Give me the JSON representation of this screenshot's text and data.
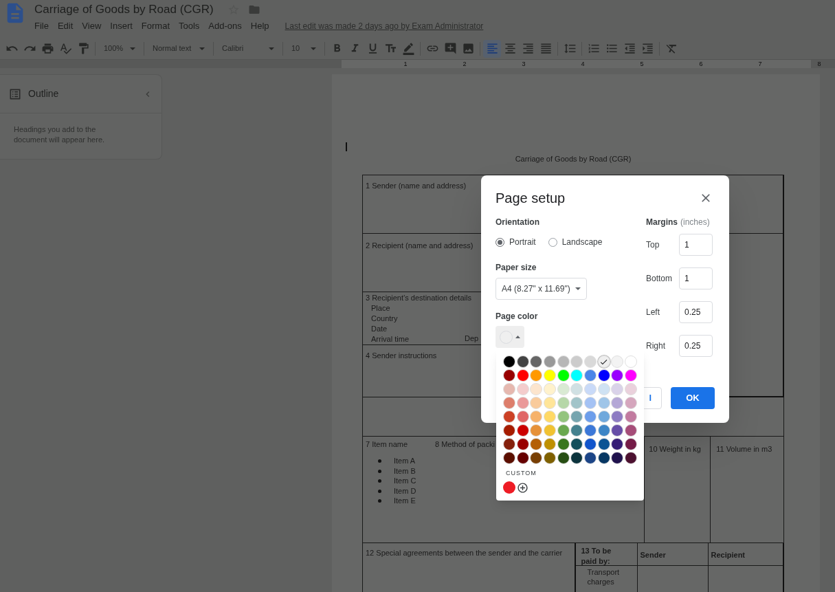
{
  "document": {
    "title": "Carriage of Goods by Road (CGR)"
  },
  "menu": [
    "File",
    "Edit",
    "View",
    "Insert",
    "Format",
    "Tools",
    "Add-ons",
    "Help"
  ],
  "last_edit": "Last edit was made 2 days ago by Exam Administrator",
  "toolbar": {
    "zoom": "100%",
    "style": "Normal text",
    "font": "Calibri",
    "size": "10",
    "align": [
      {
        "selected": true
      },
      {
        "selected": false
      },
      {
        "selected": false
      },
      {
        "selected": false
      }
    ]
  },
  "ruler": [
    "1",
    "2",
    "3",
    "4",
    "5",
    "6",
    "7",
    "8"
  ],
  "outline": {
    "title": "Outline",
    "hint": "Headings you add to the document will appear here."
  },
  "page": {
    "heading": "Carriage of Goods by Road (CGR)",
    "sender": "1 Sender (name and address)",
    "recipient": "2 Recipient (name and address)",
    "destination": {
      "title": "3 Recipient’s destination details",
      "fields": [
        "Place",
        "Country",
        "Date",
        "Arrival time"
      ],
      "column_2": "Dep"
    },
    "instructions": "4 Sender instructions",
    "items": {
      "item_name": "7 Item name",
      "packing": "8 Method of packi",
      "weight": "10 Weight in kg",
      "volume": "11 Volume in m3",
      "list": [
        "Item A",
        "Item B",
        "Item C",
        "Item D",
        "Item E"
      ]
    },
    "agreements": "12 Special agreements between the sender and the carrier",
    "payment": {
      "title": "13 To be paid by:",
      "columns": [
        "Sender",
        "Recipient"
      ],
      "rows": [
        "Transport charges"
      ]
    }
  },
  "dialog": {
    "title": "Page setup",
    "orientation": {
      "label": "Orientation",
      "options": [
        {
          "label": "Portrait",
          "selected": true
        },
        {
          "label": "Landscape",
          "selected": false
        }
      ]
    },
    "paper_size": {
      "label": "Paper size",
      "value": "A4 (8.27\" x 11.69\")"
    },
    "page_color": {
      "label": "Page color"
    },
    "margins": {
      "label": "Margins",
      "unit": "(inches)",
      "fields": [
        {
          "label": "Top",
          "value": "1"
        },
        {
          "label": "Bottom",
          "value": "1"
        },
        {
          "label": "Left",
          "value": "0.25"
        },
        {
          "label": "Right",
          "value": "0.25"
        }
      ]
    },
    "buttons": {
      "cancel": "l",
      "ok": "OK"
    }
  },
  "color_picker": {
    "palette": [
      [
        {
          "color": "#000000",
          "selected": false
        },
        {
          "color": "#434343",
          "selected": false
        },
        {
          "color": "#666666",
          "selected": false
        },
        {
          "color": "#999999",
          "selected": false
        },
        {
          "color": "#b7b7b7",
          "selected": false
        },
        {
          "color": "#cccccc",
          "selected": false
        },
        {
          "color": "#d9d9d9",
          "selected": false
        },
        {
          "color": "#efefef",
          "selected": true
        },
        {
          "color": "#f3f3f3",
          "selected": false
        },
        {
          "color": "#ffffff",
          "selected": false
        }
      ],
      [
        {
          "color": "#980000",
          "selected": false
        },
        {
          "color": "#ff0000",
          "selected": false
        },
        {
          "color": "#ff9900",
          "selected": false
        },
        {
          "color": "#ffff00",
          "selected": false
        },
        {
          "color": "#00ff00",
          "selected": false
        },
        {
          "color": "#00ffff",
          "selected": false
        },
        {
          "color": "#4a86e8",
          "selected": false
        },
        {
          "color": "#0000ff",
          "selected": false
        },
        {
          "color": "#9900ff",
          "selected": false
        },
        {
          "color": "#ff00ff",
          "selected": false
        }
      ],
      [
        {
          "color": "#e6b8af",
          "selected": false
        },
        {
          "color": "#f4cccc",
          "selected": false
        },
        {
          "color": "#fce5cd",
          "selected": false
        },
        {
          "color": "#fff2cc",
          "selected": false
        },
        {
          "color": "#d9ead3",
          "selected": false
        },
        {
          "color": "#d0e0e3",
          "selected": false
        },
        {
          "color": "#c9daf8",
          "selected": false
        },
        {
          "color": "#cfe2f3",
          "selected": false
        },
        {
          "color": "#d9d2e9",
          "selected": false
        },
        {
          "color": "#ead1dc",
          "selected": false
        }
      ],
      [
        {
          "color": "#dd7e6b",
          "selected": false
        },
        {
          "color": "#ea9999",
          "selected": false
        },
        {
          "color": "#f9cb9c",
          "selected": false
        },
        {
          "color": "#ffe599",
          "selected": false
        },
        {
          "color": "#b6d7a8",
          "selected": false
        },
        {
          "color": "#a2c4c9",
          "selected": false
        },
        {
          "color": "#a4c2f4",
          "selected": false
        },
        {
          "color": "#9fc5e8",
          "selected": false
        },
        {
          "color": "#b4a7d6",
          "selected": false
        },
        {
          "color": "#d5a6bd",
          "selected": false
        }
      ],
      [
        {
          "color": "#cc4125",
          "selected": false
        },
        {
          "color": "#e06666",
          "selected": false
        },
        {
          "color": "#f6b26b",
          "selected": false
        },
        {
          "color": "#ffd966",
          "selected": false
        },
        {
          "color": "#93c47d",
          "selected": false
        },
        {
          "color": "#76a5af",
          "selected": false
        },
        {
          "color": "#6d9eeb",
          "selected": false
        },
        {
          "color": "#6fa8dc",
          "selected": false
        },
        {
          "color": "#8e7cc3",
          "selected": false
        },
        {
          "color": "#c27ba0",
          "selected": false
        }
      ],
      [
        {
          "color": "#a61c00",
          "selected": false
        },
        {
          "color": "#cc0000",
          "selected": false
        },
        {
          "color": "#e69138",
          "selected": false
        },
        {
          "color": "#f1c232",
          "selected": false
        },
        {
          "color": "#6aa84f",
          "selected": false
        },
        {
          "color": "#45818e",
          "selected": false
        },
        {
          "color": "#3c78d8",
          "selected": false
        },
        {
          "color": "#3d85c6",
          "selected": false
        },
        {
          "color": "#674ea7",
          "selected": false
        },
        {
          "color": "#a64d79",
          "selected": false
        }
      ],
      [
        {
          "color": "#85200c",
          "selected": false
        },
        {
          "color": "#990000",
          "selected": false
        },
        {
          "color": "#b45f06",
          "selected": false
        },
        {
          "color": "#bf9000",
          "selected": false
        },
        {
          "color": "#38761d",
          "selected": false
        },
        {
          "color": "#134f5c",
          "selected": false
        },
        {
          "color": "#1155cc",
          "selected": false
        },
        {
          "color": "#0b5394",
          "selected": false
        },
        {
          "color": "#351c75",
          "selected": false
        },
        {
          "color": "#741b47",
          "selected": false
        }
      ],
      [
        {
          "color": "#5b0f00",
          "selected": false
        },
        {
          "color": "#660000",
          "selected": false
        },
        {
          "color": "#783f04",
          "selected": false
        },
        {
          "color": "#7f6000",
          "selected": false
        },
        {
          "color": "#274e13",
          "selected": false
        },
        {
          "color": "#0c343d",
          "selected": false
        },
        {
          "color": "#1c4587",
          "selected": false
        },
        {
          "color": "#073763",
          "selected": false
        },
        {
          "color": "#20124d",
          "selected": false
        },
        {
          "color": "#4c1130",
          "selected": false
        }
      ]
    ],
    "custom_label": "CUSTOM",
    "custom": [
      {
        "color": "#ee1c25"
      }
    ]
  }
}
